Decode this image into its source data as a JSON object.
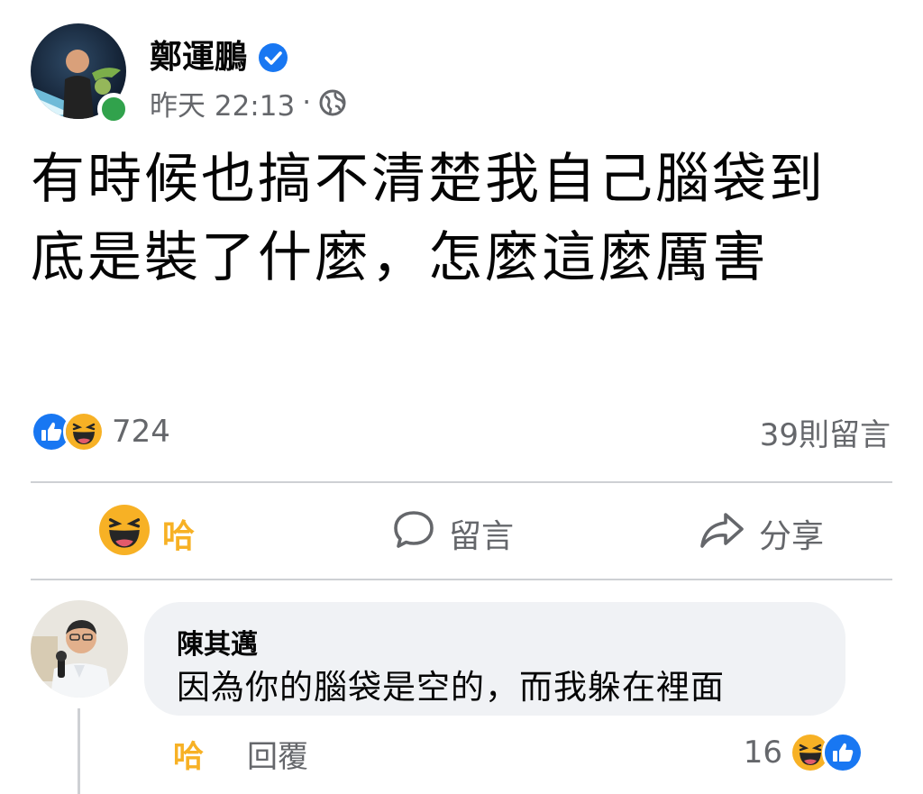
{
  "post": {
    "author": "鄭運鵬",
    "timestamp": "昨天 22:13",
    "separator": "·",
    "text": "有時候也搞不清楚我自己腦袋到底是裝了什麼，怎麼這麼厲害",
    "reaction_count": "724",
    "comment_count": "39則留言"
  },
  "actions": {
    "haha_label": "哈",
    "comment_label": "留言",
    "share_label": "分享"
  },
  "comment": {
    "author": "陳其邁",
    "text": "因為你的腦袋是空的，而我躲在裡面",
    "haha_label": "哈",
    "reply_label": "回覆",
    "reaction_count": "16"
  },
  "icons": {
    "verified": "verified-badge-icon",
    "audience": "globe-icon",
    "like": "like-reaction-icon",
    "haha": "haha-reaction-icon",
    "comment": "comment-bubble-icon",
    "share": "share-arrow-icon"
  },
  "colors": {
    "facebook_blue": "#1877f2",
    "haha_yellow": "#f7b125",
    "online_green": "#31a24c",
    "secondary_text": "#65676b",
    "comment_bubble": "#f0f2f5"
  }
}
